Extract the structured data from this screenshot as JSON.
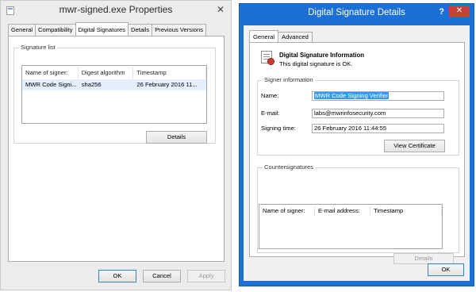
{
  "properties_window": {
    "title": "mwr-signed.exe Properties",
    "close_glyph": "✕",
    "tabs": [
      "General",
      "Compatibility",
      "Digital Signatures",
      "Details",
      "Previous Versions"
    ],
    "active_tab": "Digital Signatures",
    "signature_list": {
      "label": "Signature list",
      "columns": [
        "Name of signer:",
        "Digest algorithm",
        "Timestamp"
      ],
      "rows": [
        [
          "MWR Code Signi...",
          "sha256",
          "26 February 2016 11..."
        ]
      ]
    },
    "details_button": "Details",
    "footer_buttons": {
      "ok": "OK",
      "cancel": "Cancel",
      "apply": "Apply"
    }
  },
  "details_window": {
    "title": "Digital Signature Details",
    "help_glyph": "?",
    "close_glyph": "✕",
    "title_bar_color": "#1c6fd6",
    "tabs": [
      "General",
      "Advanced"
    ],
    "active_tab": "General",
    "info": {
      "heading": "Digital Signature Information",
      "status": "This digital signature is OK."
    },
    "signer_information": {
      "label": "Signer information",
      "name_label": "Name:",
      "name_value": "MWR Code Signing Verifier",
      "email_label": "E-mail:",
      "email_value": "labs@mwrinfosecurity.com",
      "signing_time_label": "Signing time:",
      "signing_time_value": "26 February 2016 11:44:55",
      "view_certificate_button": "View Certificate"
    },
    "countersignatures": {
      "label": "Countersignatures",
      "columns": [
        "Name of signer:",
        "E-mail address:",
        "Timestamp"
      ],
      "details_button": "Details"
    },
    "ok_button": "OK"
  }
}
